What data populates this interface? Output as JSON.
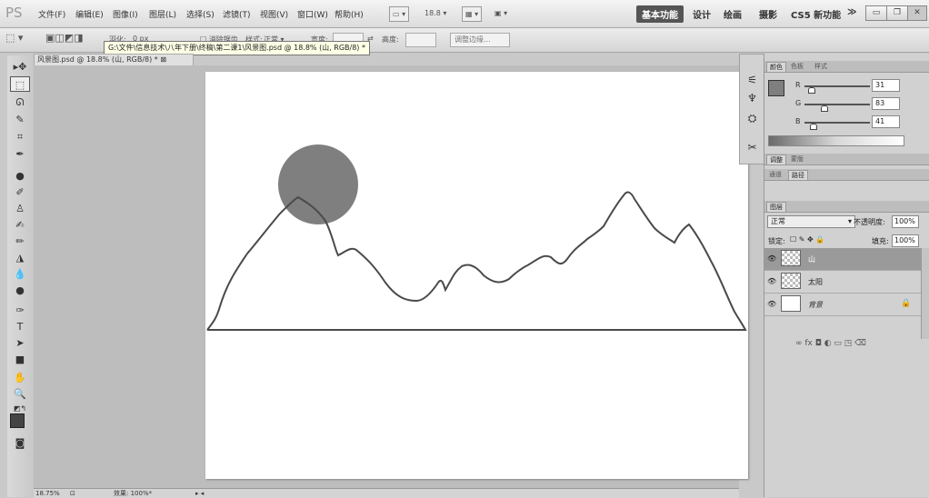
{
  "menubar": {
    "logo": "PS",
    "items": [
      "文件(F)",
      "编辑(E)",
      "图像(I)",
      "图层(L)",
      "选择(S)",
      "滤镜(T)",
      "视图(V)",
      "窗口(W)",
      "帮助(H)"
    ],
    "zoom": "18.8",
    "workspaces": [
      "基本功能",
      "设计",
      "绘画",
      "摄影",
      "CS5 新功能"
    ],
    "more": "≫"
  },
  "optbar": {
    "feather_label": "羽化:",
    "feather_value": "0 px",
    "antialias_label": "消除锯齿",
    "style_label": "样式:",
    "style_value": "正常",
    "width_label": "宽度:",
    "height_label": "高度:",
    "refine_edge": "调整边缘..."
  },
  "tooltip": "G:\\文件\\信息技术\\八年下册\\终稿\\第二课1\\风景图.psd @ 18.8% (山, RGB/8) *",
  "doctab": "风景图.psd @ 18.8% (山, RGB/8) * ⊠",
  "status": {
    "zoom": "18.75%",
    "doc": "效果: 100%*"
  },
  "color_panel": {
    "tabs": [
      "颜色",
      "色板",
      "样式"
    ],
    "r_label": "R",
    "g_label": "G",
    "b_label": "B",
    "r": "31",
    "g": "83",
    "b": "41",
    "fg_color": "#7f7f7f"
  },
  "adjust_panel": {
    "tabs": [
      "调整",
      "蒙版"
    ]
  },
  "channels_panel": {
    "tabs": [
      "通道",
      "路径"
    ]
  },
  "layers_panel": {
    "tab": "图层",
    "blend_mode": "正常",
    "opacity_label": "不透明度:",
    "opacity": "100%",
    "lock_label": "锁定:",
    "fill_label": "填充:",
    "fill": "100%",
    "layers": [
      {
        "name": "山",
        "selected": true
      },
      {
        "name": "太阳",
        "selected": false
      },
      {
        "name": "背景",
        "selected": false
      }
    ],
    "bottom_icons": "∞ fx ◘ ◐ ▭ ◳ ⌫"
  },
  "artwork": {
    "sun_color": "#7f7f7f",
    "stroke_color": "#4a4a4a"
  }
}
